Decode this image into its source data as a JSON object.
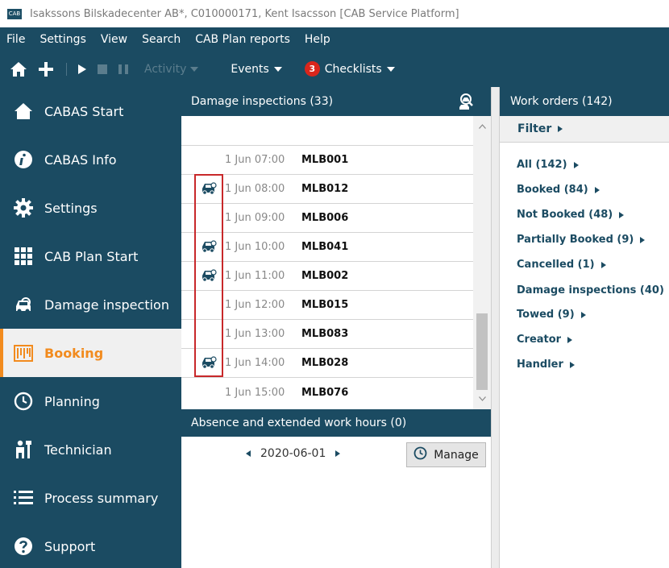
{
  "window": {
    "logo_text": "CAB",
    "title": "Isakssons Bilskadecenter AB*, C010000171, Kent Isacsson [CAB Service Platform]"
  },
  "menu": [
    "File",
    "Settings",
    "View",
    "Search",
    "CAB Plan reports",
    "Help"
  ],
  "toolbar": {
    "activity_label": "Activity",
    "events_label": "Events",
    "checklists_label": "Checklists",
    "checklists_count": "3"
  },
  "sidebar": {
    "items": [
      {
        "label": "CABAS Start",
        "icon": "house-icon"
      },
      {
        "label": "CABAS Info",
        "icon": "info-icon"
      },
      {
        "label": "Settings",
        "icon": "gear-icon"
      },
      {
        "label": "CAB Plan Start",
        "icon": "grid-icon"
      },
      {
        "label": "Damage inspection",
        "icon": "car-inspection-icon"
      },
      {
        "label": "Booking",
        "icon": "booking-icon",
        "active": true
      },
      {
        "label": "Planning",
        "icon": "clock-icon"
      },
      {
        "label": "Technician",
        "icon": "technician-icon"
      },
      {
        "label": "Process summary",
        "icon": "list-icon"
      },
      {
        "label": "Support",
        "icon": "help-icon"
      }
    ]
  },
  "damage_inspections": {
    "title": "Damage inspections (33)",
    "rows": [
      {
        "time": "1 Jun 07:00",
        "code": "MLB001",
        "has_car": false
      },
      {
        "time": "1 Jun 08:00",
        "code": "MLB012",
        "has_car": true
      },
      {
        "time": "1 Jun 09:00",
        "code": "MLB006",
        "has_car": false
      },
      {
        "time": "1 Jun 10:00",
        "code": "MLB041",
        "has_car": true
      },
      {
        "time": "1 Jun 11:00",
        "code": "MLB002",
        "has_car": true
      },
      {
        "time": "1 Jun 12:00",
        "code": "MLB015",
        "has_car": false
      },
      {
        "time": "1 Jun 13:00",
        "code": "MLB083",
        "has_car": false
      },
      {
        "time": "1 Jun 14:00",
        "code": "MLB028",
        "has_car": true
      },
      {
        "time": "1 Jun 15:00",
        "code": "MLB076",
        "has_car": false
      }
    ]
  },
  "absence": {
    "title": "Absence and extended work hours (0)",
    "date": "2020-06-01",
    "manage_label": "Manage"
  },
  "work_orders": {
    "title": "Work orders (142)",
    "filter_label": "Filter",
    "filters": [
      "All (142)",
      "Booked (84)",
      "Not Booked (48)",
      "Partially Booked (9)",
      "Cancelled (1)",
      "Damage inspections (40)",
      "Towed (9)",
      "Creator",
      "Handler"
    ]
  },
  "colors": {
    "primary": "#1b4b62",
    "accent": "#f28b1e",
    "badge": "#d9261c",
    "highlight": "#c8282a"
  }
}
